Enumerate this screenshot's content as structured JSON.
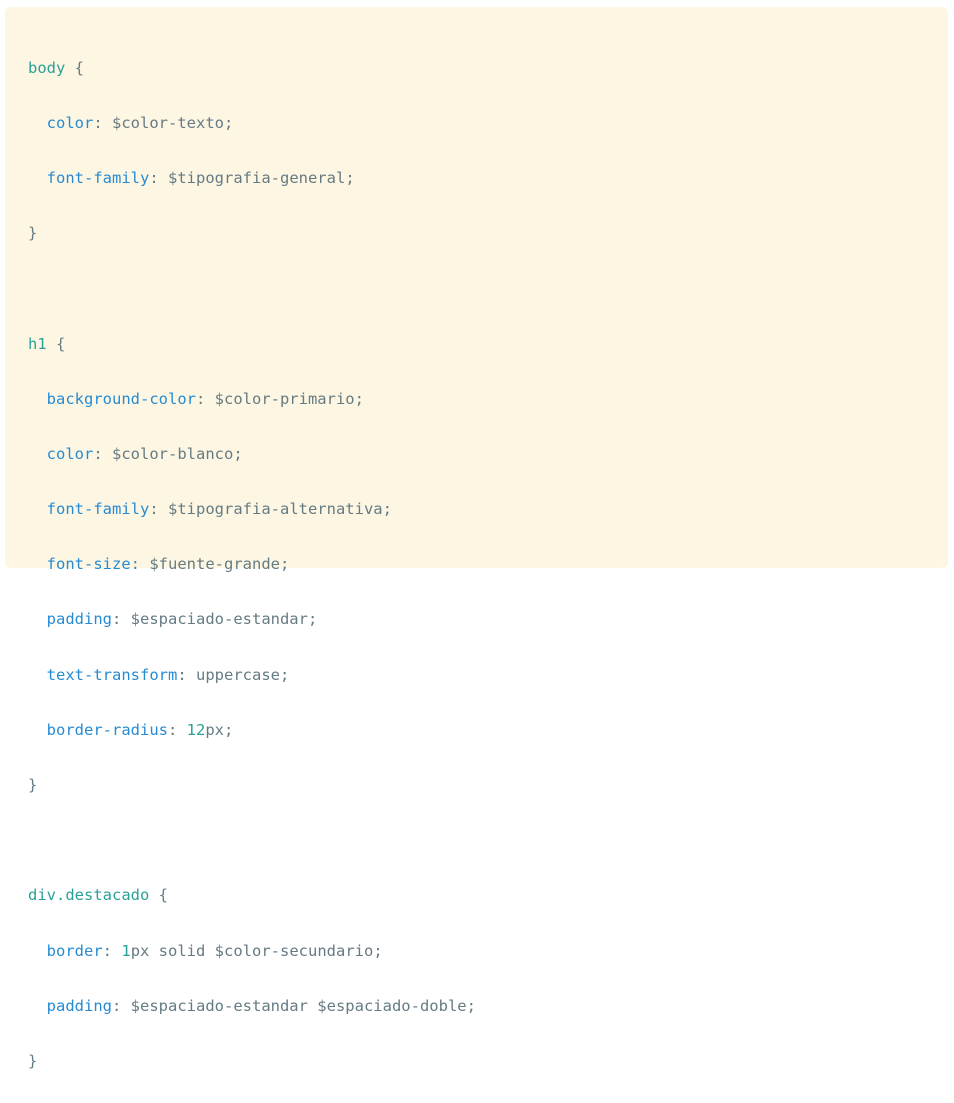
{
  "code": {
    "rules": [
      {
        "selector": "body",
        "declarations": [
          {
            "property": "color",
            "value": "$color-texto"
          },
          {
            "property": "font-family",
            "value": "$tipografia-general"
          }
        ]
      },
      {
        "selector": "h1",
        "declarations": [
          {
            "property": "background-color",
            "value": "$color-primario"
          },
          {
            "property": "color",
            "value": "$color-blanco"
          },
          {
            "property": "font-family",
            "value": "$tipografia-alternativa"
          },
          {
            "property": "font-size",
            "value": "$fuente-grande"
          },
          {
            "property": "padding",
            "value": "$espaciado-estandar"
          },
          {
            "property": "text-transform",
            "value": "uppercase"
          },
          {
            "property": "border-radius",
            "value_num": "12",
            "value": "px"
          }
        ]
      },
      {
        "selector": "div.destacado",
        "declarations": [
          {
            "property": "border",
            "value_num": "1",
            "value": "px solid $color-secundario"
          },
          {
            "property": "padding",
            "value": "$espaciado-estandar $espaciado-doble"
          }
        ]
      }
    ],
    "punctuation": {
      "open": " {",
      "close": "}",
      "colon": ": ",
      "semicolon": ";"
    }
  },
  "colors": {
    "background": "#fdf6e3",
    "selector": "#2aa198",
    "property": "#268bd2",
    "text": "#657b83"
  }
}
